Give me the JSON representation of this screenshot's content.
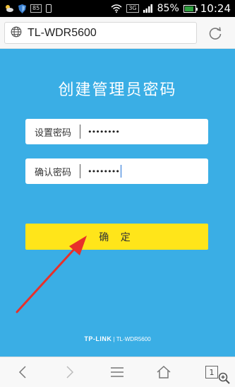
{
  "status_bar": {
    "badge_text": "85",
    "network_label": "3G",
    "battery_percent": "85%",
    "battery_level": 0.85,
    "time": "10:24"
  },
  "browser": {
    "url": "TL-WDR5600"
  },
  "router_page": {
    "title": "创建管理员密码",
    "password_label": "设置密码",
    "password_value": "••••••••",
    "confirm_label": "确认密码",
    "confirm_value": "••••••••",
    "confirm_button": "确 定",
    "brand_logo": "TP-LINK",
    "brand_model": "| TL-WDR5600",
    "background_color": "#3aaee5",
    "button_color": "#ffe51a",
    "arrow_color": "#e8302a"
  },
  "nav_bar": {
    "tabs_count": "1"
  }
}
